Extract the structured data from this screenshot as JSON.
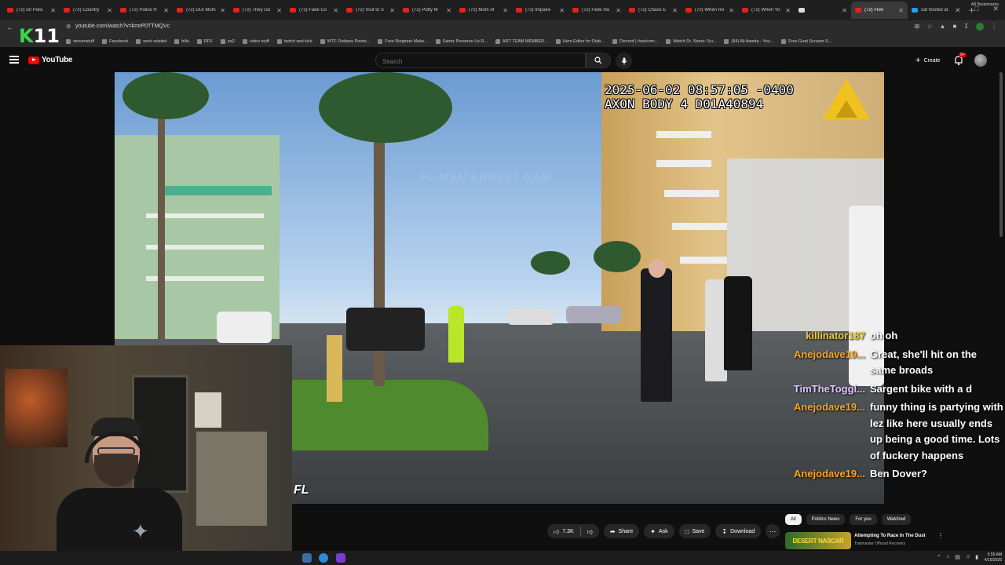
{
  "browser": {
    "tabs": [
      {
        "label": "(72) 50 Polic",
        "fav": "red"
      },
      {
        "label": "(72) Country",
        "fav": "red"
      },
      {
        "label": "(72) Police H",
        "fav": "red"
      },
      {
        "label": "(72) DUI Mom",
        "fav": "red"
      },
      {
        "label": "(72) They Go",
        "fav": "red"
      },
      {
        "label": "(72) Fake Co",
        "fav": "red"
      },
      {
        "label": "(72) Visit to S",
        "fav": "red"
      },
      {
        "label": "(72) Potty M",
        "fav": "red"
      },
      {
        "label": "(72) Mom of",
        "fav": "red"
      },
      {
        "label": "(72) Impaire",
        "fav": "red"
      },
      {
        "label": "(72) Feds Ha",
        "fav": "red"
      },
      {
        "label": "(72) Chaos E",
        "fav": "red"
      },
      {
        "label": "(72) When Ro",
        "fav": "red"
      },
      {
        "label": "(72) When Yo",
        "fav": "red"
      },
      {
        "label": "",
        "fav": "white"
      },
      {
        "label": "(72) Flori",
        "fav": "red",
        "active": true
      },
      {
        "label": "cat hosted at",
        "fav": "blue"
      }
    ],
    "url": "youtube.com/watch?v=kmrP0TTMQVc",
    "bookmarks": [
      "streamstuff",
      "Facebook",
      "work related",
      "bills",
      "RFS",
      "eq2",
      "video stuff",
      "twitch and kick",
      "WTF Outlaws Points...",
      "Free Ringtone Make...",
      "Saints Preserve Us R...",
      "ART TEAM MEMBER...",
      "Hero Editor for Diab...",
      "Discord | #welcom...",
      "Watch Dr. Stone: Sci...",
      "(84) Ali Aweda - You...",
      "Free Goat Scream S..."
    ],
    "bookmarks_all": "All Bookmarks"
  },
  "overlay": {
    "logo_k": "K",
    "logo_num": "11"
  },
  "youtube": {
    "logo_text": "YouTube",
    "search_placeholder": "Search",
    "create_label": "Create",
    "notif_count": "9+"
  },
  "video": {
    "timestamp_line1": "2025-06-02 08:57:05 -0400",
    "timestamp_line2": "AXON BODY 4 D01A40894",
    "watermark": "FL MAN ARREST CAM",
    "corner_text": "FL"
  },
  "chat": [
    {
      "user": "killinator187",
      "color": "#f3c63f",
      "text": "oh oh"
    },
    {
      "user": "Anejodave19...",
      "color": "#f5a623",
      "text": "Great, she'll hit on the same broads"
    },
    {
      "user": "TimTheToggl...",
      "color": "#e0c0ff",
      "text": "Sargent bike with a d"
    },
    {
      "user": "Anejodave19...",
      "color": "#f5a623",
      "text": "funny thing is partying with lez like here usually ends up being a good time. Lots of fuckery happens"
    },
    {
      "user": "Anejodave19...",
      "color": "#f5a623",
      "text": "Ben Dover?"
    }
  ],
  "actions": {
    "like_count": "7.3K",
    "share_label": "Share",
    "ask_label": "Ask",
    "save_label": "Save",
    "download_label": "Download"
  },
  "chips": [
    "All",
    "Politics News",
    "For you",
    "Watched"
  ],
  "recommendation": {
    "thumb_text": "DESERT NASCAR",
    "title": "Attempting To Race In The Dust",
    "channel": "Trailmaster Offroad Recovery"
  },
  "taskbar": {
    "time": "6:55 AM",
    "date": "4/15/2026"
  }
}
